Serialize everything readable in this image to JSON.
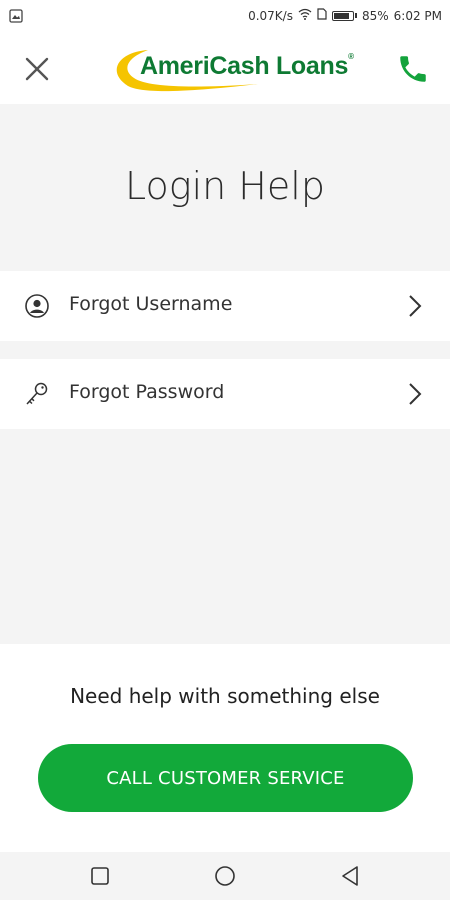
{
  "status_bar": {
    "speed": "0.07K/s",
    "battery": "85%",
    "battery_level": 0.85,
    "time": "6:02 PM",
    "icons": [
      "gallery-icon",
      "wifi-icon",
      "sim-icon",
      "battery-icon"
    ]
  },
  "header": {
    "close_icon": "close-icon",
    "logo_text": "AmeriCash Loans",
    "logo_mark": "®",
    "phone_icon": "phone-icon",
    "brand_color": "#0e7a33",
    "accent_color": "#f5c400"
  },
  "main": {
    "title": "Login Help",
    "options": [
      {
        "label": "Forgot Username",
        "icon": "user-circle-icon"
      },
      {
        "label": "Forgot Password",
        "icon": "key-icon"
      }
    ]
  },
  "footer": {
    "help_text": "Need help with something else",
    "cta_label": "CALL CUSTOMER SERVICE",
    "cta_color": "#12a93a"
  },
  "nav_bar": {
    "buttons": [
      "recent-apps-icon",
      "home-icon",
      "back-icon"
    ]
  }
}
